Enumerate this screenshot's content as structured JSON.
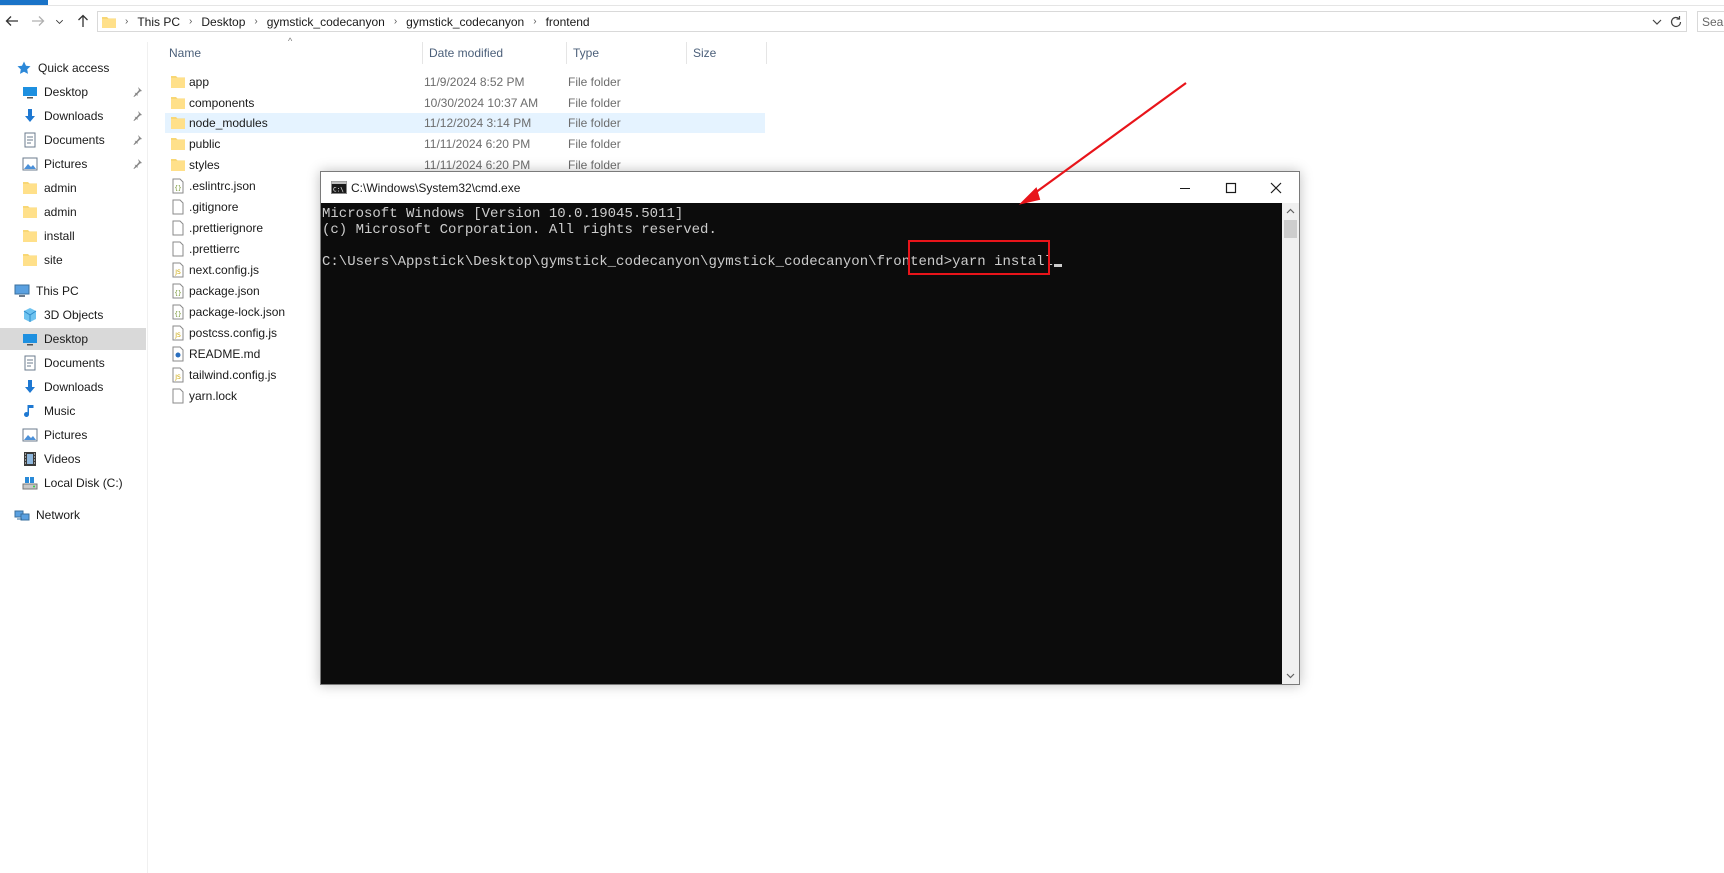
{
  "address_bar": {
    "crumbs": [
      "This PC",
      "Desktop",
      "gymstick_codecanyon",
      "gymstick_codecanyon",
      "frontend"
    ],
    "search_placeholder": "Search frontend"
  },
  "nav_pane": {
    "items": [
      {
        "label": "Quick access",
        "icon": "star-icon"
      },
      {
        "label": "Desktop",
        "icon": "desktop-icon",
        "pinned": true
      },
      {
        "label": "Downloads",
        "icon": "download-arrow-icon",
        "pinned": true
      },
      {
        "label": "Documents",
        "icon": "documents-icon",
        "pinned": true
      },
      {
        "label": "Pictures",
        "icon": "pictures-icon",
        "pinned": true
      },
      {
        "label": "admin",
        "icon": "folder-icon"
      },
      {
        "label": "admin",
        "icon": "folder-icon"
      },
      {
        "label": "install",
        "icon": "folder-icon"
      },
      {
        "label": "site",
        "icon": "folder-icon"
      },
      {
        "label": "This PC",
        "icon": "computer-icon"
      },
      {
        "label": "3D Objects",
        "icon": "cube-icon"
      },
      {
        "label": "Desktop",
        "icon": "desktop-icon",
        "selected": true
      },
      {
        "label": "Documents",
        "icon": "documents-icon"
      },
      {
        "label": "Downloads",
        "icon": "download-arrow-icon"
      },
      {
        "label": "Music",
        "icon": "music-note-icon"
      },
      {
        "label": "Pictures",
        "icon": "pictures-icon"
      },
      {
        "label": "Videos",
        "icon": "film-icon"
      },
      {
        "label": "Local Disk (C:)",
        "icon": "drive-icon"
      },
      {
        "label": "Network",
        "icon": "network-icon"
      }
    ]
  },
  "file_list": {
    "columns": [
      "Name",
      "Date modified",
      "Type",
      "Size"
    ],
    "rows": [
      {
        "name": "app",
        "date": "11/9/2024 8:52 PM",
        "type": "File folder",
        "icon": "folder-icon"
      },
      {
        "name": "components",
        "date": "10/30/2024 10:37 AM",
        "type": "File folder",
        "icon": "folder-icon"
      },
      {
        "name": "node_modules",
        "date": "11/12/2024 3:14 PM",
        "type": "File folder",
        "icon": "folder-icon",
        "selected": true
      },
      {
        "name": "public",
        "date": "11/11/2024 6:20 PM",
        "type": "File folder",
        "icon": "folder-icon"
      },
      {
        "name": "styles",
        "date": "11/11/2024 6:20 PM",
        "type": "File folder",
        "icon": "folder-icon"
      },
      {
        "name": ".eslintrc.json",
        "icon": "json-file-icon"
      },
      {
        "name": ".gitignore",
        "icon": "file-icon"
      },
      {
        "name": ".prettierignore",
        "icon": "file-icon"
      },
      {
        "name": ".prettierrc",
        "icon": "file-icon"
      },
      {
        "name": "next.config.js",
        "icon": "js-file-icon"
      },
      {
        "name": "package.json",
        "icon": "json-file-icon"
      },
      {
        "name": "package-lock.json",
        "icon": "json-file-icon"
      },
      {
        "name": "postcss.config.js",
        "icon": "js-file-icon"
      },
      {
        "name": "README.md",
        "icon": "markdown-file-icon"
      },
      {
        "name": "tailwind.config.js",
        "icon": "js-file-icon"
      },
      {
        "name": "yarn.lock",
        "icon": "file-icon"
      }
    ]
  },
  "cmd_window": {
    "title": "C:\\Windows\\System32\\cmd.exe",
    "lines": [
      "Microsoft Windows [Version 10.0.19045.5011]",
      "(c) Microsoft Corporation. All rights reserved.",
      "",
      "C:\\Users\\Appstick\\Desktop\\gymstick_codecanyon\\gymstick_codecanyon\\frontend>yarn install"
    ]
  },
  "colors": {
    "annotation": "#e8141a",
    "console_bg": "#0c0c0c",
    "console_text": "#cccccc",
    "selection": "#e5f3ff",
    "folder": "#f8d775"
  }
}
